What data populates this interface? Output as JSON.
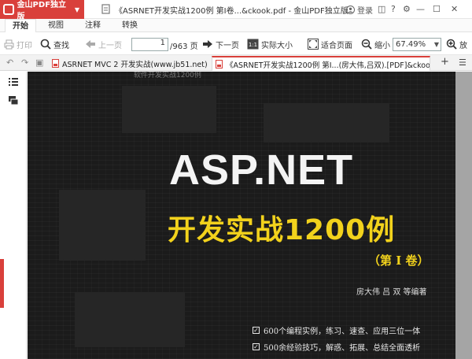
{
  "app": {
    "name": "金山PDF独立版",
    "window_title": "《ASRNET开发实战1200例 第I卷...&ckook.pdf - 金山PDF独立版"
  },
  "account": {
    "login_label": "登录"
  },
  "menu_tabs": [
    {
      "label": "开始",
      "active": true
    },
    {
      "label": "视图",
      "active": false
    },
    {
      "label": "注释",
      "active": false
    },
    {
      "label": "转换",
      "active": false
    }
  ],
  "toolbar": {
    "print": "打印",
    "find": "查找",
    "prev_page": "上一页",
    "page_current": "1",
    "page_total": "/963 页",
    "next_page": "下一页",
    "actual_size": "实际大小",
    "fit_page": "适合页面",
    "zoom_out": "缩小",
    "zoom_value": "67.49%",
    "zoom_in_partial": "放"
  },
  "doc_tabs": [
    {
      "label": "ASRNET MVC 2 开发实战(www.jb51.net)",
      "active": false
    },
    {
      "label": "《ASRNET开发实战1200例 第I...(房大伟,吕双).[PDF]&ckook",
      "active": true
    }
  ],
  "page_content": {
    "top_subtitle": "软件开发实战1200例",
    "title_en": "ASP.NET",
    "title_cn": "开发实战1200例",
    "volume": "（第 I 卷）",
    "authors": "房大伟  吕    双  等编著",
    "bullets": [
      "600个编程实例，练习、速查、应用三位一体",
      "500余经验技巧，解惑、拓展、总结全面透析"
    ]
  },
  "colors": {
    "brand": "#d9403b",
    "title_yellow": "#f2d21c",
    "page_bg": "#1b1b1b"
  }
}
